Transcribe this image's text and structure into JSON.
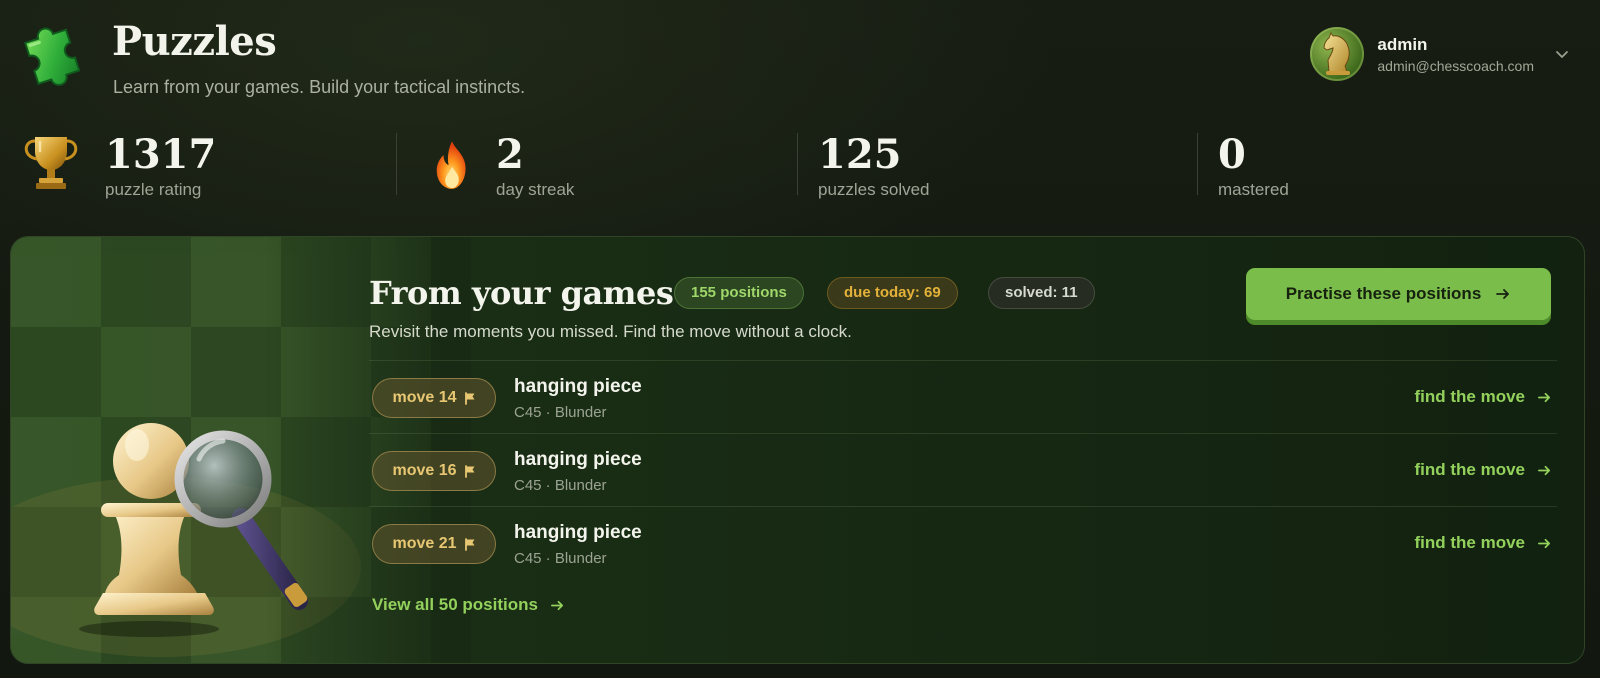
{
  "header": {
    "logo_icon": "puzzle-piece-icon",
    "title": "Puzzles",
    "subtitle": "Learn from your games. Build your tactical instincts."
  },
  "user": {
    "avatar_icon": "knight-avatar-icon",
    "name": "admin",
    "email": "admin@chesscoach.com",
    "menu_icon": "chevron-down-icon"
  },
  "stats": [
    {
      "icon": "trophy-icon",
      "value": "1317",
      "label": "puzzle rating"
    },
    {
      "icon": "fire-icon",
      "value": "2",
      "label": "day streak"
    },
    {
      "icon": "",
      "value": "125",
      "label": "puzzles solved"
    },
    {
      "icon": "",
      "value": "0",
      "label": "mastered"
    }
  ],
  "card": {
    "title": "From your games",
    "badges": {
      "positions": "155 positions",
      "due": "due today: 69",
      "solved": "solved: 11"
    },
    "cta_label": "Practise these positions",
    "subtitle": "Revisit the moments you missed. Find the move without a clock.",
    "rows": [
      {
        "move": "move 14",
        "title": "hanging piece",
        "meta": "C45 · Blunder",
        "action": "find the move"
      },
      {
        "move": "move 16",
        "title": "hanging piece",
        "meta": "C45 · Blunder",
        "action": "find the move"
      },
      {
        "move": "move 21",
        "title": "hanging piece",
        "meta": "C45 · Blunder",
        "action": "find the move"
      }
    ],
    "view_all": "View all 50 positions"
  },
  "colors": {
    "accent_green": "#7bbd4a",
    "link_green": "#93d15c",
    "amber": "#e3b13a",
    "background": "#13180f"
  }
}
